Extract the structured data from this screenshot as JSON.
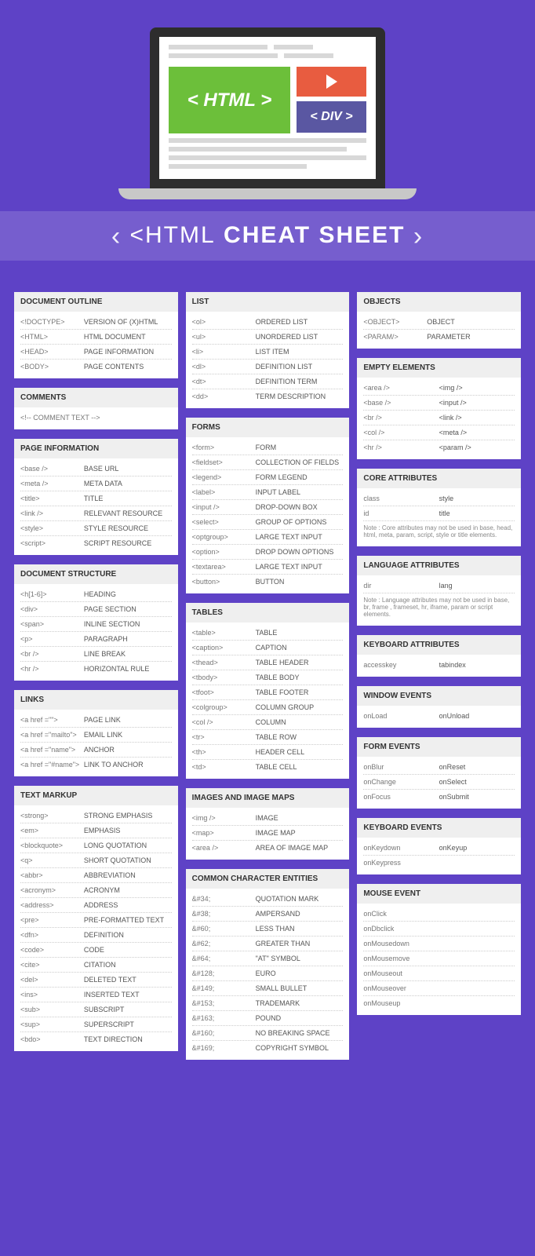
{
  "hero": {
    "htmlLabel": "< HTML >",
    "divLabel": "< DIV >"
  },
  "title": {
    "prefix": "<HTML",
    "bold": "CHEAT SHEET",
    "suffix": ">"
  },
  "col1": [
    {
      "title": "DOCUMENT OUTLINE",
      "rows": [
        [
          "<!DOCTYPE>",
          "VERSION OF (X)HTML"
        ],
        [
          "<HTML>",
          "HTML DOCUMENT"
        ],
        [
          "<HEAD>",
          "PAGE INFORMATION"
        ],
        [
          "<BODY>",
          "PAGE CONTENTS"
        ]
      ]
    },
    {
      "title": "COMMENTS",
      "rows": [
        [
          "<!-- COMMENT TEXT -->",
          ""
        ]
      ],
      "single": true
    },
    {
      "title": "PAGE INFORMATION",
      "rows": [
        [
          "<base />",
          "BASE URL"
        ],
        [
          "<meta />",
          "META DATA"
        ],
        [
          "<title>",
          "TITLE"
        ],
        [
          "<link />",
          "RELEVANT RESOURCE"
        ],
        [
          "<style>",
          "STYLE RESOURCE"
        ],
        [
          "<script>",
          "SCRIPT RESOURCE"
        ]
      ]
    },
    {
      "title": "DOCUMENT STRUCTURE",
      "rows": [
        [
          "<h[1-6]>",
          "HEADING"
        ],
        [
          "<div>",
          "PAGE SECTION"
        ],
        [
          "<span>",
          "INLINE SECTION"
        ],
        [
          "<p>",
          "PARAGRAPH"
        ],
        [
          "<br />",
          "LINE BREAK"
        ],
        [
          "<hr />",
          "HORIZONTAL RULE"
        ]
      ]
    },
    {
      "title": "LINKS",
      "rows": [
        [
          "<a href =\"\">",
          "PAGE LINK"
        ],
        [
          "<a href =\"mailto\">",
          "EMAIL LINK"
        ],
        [
          "<a href =\"name\">",
          "ANCHOR"
        ],
        [
          "<a href =\"#name\">",
          "LINK TO ANCHOR"
        ]
      ]
    },
    {
      "title": "TEXT MARKUP",
      "rows": [
        [
          "<strong>",
          "STRONG EMPHASIS"
        ],
        [
          "<em>",
          "EMPHASIS"
        ],
        [
          "<blockquote>",
          "LONG QUOTATION"
        ],
        [
          "<q>",
          "SHORT QUOTATION"
        ],
        [
          "<abbr>",
          "ABBREVIATION"
        ],
        [
          "<acronym>",
          "ACRONYM"
        ],
        [
          "<address>",
          "ADDRESS"
        ],
        [
          "<pre>",
          "PRE-FORMATTED TEXT"
        ],
        [
          "<dfn>",
          "DEFINITION"
        ],
        [
          "<code>",
          "CODE"
        ],
        [
          "<cite>",
          "CITATION"
        ],
        [
          "<del>",
          "DELETED TEXT"
        ],
        [
          "<ins>",
          "INSERTED TEXT"
        ],
        [
          "<sub>",
          "SUBSCRIPT"
        ],
        [
          "<sup>",
          "SUPERSCRIPT"
        ],
        [
          "<bdo>",
          "TEXT DIRECTION"
        ]
      ]
    }
  ],
  "col2": [
    {
      "title": "LIST",
      "rows": [
        [
          "<ol>",
          "ORDERED LIST"
        ],
        [
          "<ul>",
          "UNORDERED LIST"
        ],
        [
          "<li>",
          "LIST ITEM"
        ],
        [
          "<dl>",
          "DEFINITION LIST"
        ],
        [
          "<dt>",
          "DEFINITION TERM"
        ],
        [
          "<dd>",
          "TERM DESCRIPTION"
        ]
      ]
    },
    {
      "title": "FORMS",
      "rows": [
        [
          "<form>",
          "FORM"
        ],
        [
          "<fieldset>",
          "COLLECTION OF FIELDS"
        ],
        [
          "<legend>",
          "FORM LEGEND"
        ],
        [
          "<label>",
          "INPUT LABEL"
        ],
        [
          "<input />",
          "DROP-DOWN BOX"
        ],
        [
          "<select>",
          "GROUP OF OPTIONS"
        ],
        [
          "<optgroup>",
          "LARGE TEXT INPUT"
        ],
        [
          "<option>",
          "DROP DOWN OPTIONS"
        ],
        [
          "<textarea>",
          "LARGE TEXT INPUT"
        ],
        [
          "<button>",
          "BUTTON"
        ]
      ]
    },
    {
      "title": "TABLES",
      "rows": [
        [
          "<table>",
          "TABLE"
        ],
        [
          "<caption>",
          "CAPTION"
        ],
        [
          "<thead>",
          "TABLE HEADER"
        ],
        [
          "<tbody>",
          "TABLE BODY"
        ],
        [
          "<tfoot>",
          "TABLE FOOTER"
        ],
        [
          "<colgroup>",
          "COLUMN GROUP"
        ],
        [
          "<col />",
          "COLUMN"
        ],
        [
          "<tr>",
          "TABLE ROW"
        ],
        [
          "<th>",
          "HEADER CELL"
        ],
        [
          "<td>",
          "TABLE CELL"
        ]
      ]
    },
    {
      "title": "IMAGES AND IMAGE MAPS",
      "rows": [
        [
          "<img />",
          "IMAGE"
        ],
        [
          "<map>",
          "IMAGE MAP"
        ],
        [
          "<area />",
          "AREA OF IMAGE MAP"
        ]
      ]
    },
    {
      "title": "COMMON CHARACTER ENTITIES",
      "rows": [
        [
          "&#34;",
          "QUOTATION MARK"
        ],
        [
          "&#38;",
          "AMPERSAND"
        ],
        [
          "&#60;",
          "LESS THAN"
        ],
        [
          "&#62;",
          "GREATER THAN"
        ],
        [
          "&#64;",
          "\"AT\" SYMBOL"
        ],
        [
          "&#128;",
          "EURO"
        ],
        [
          "&#149;",
          "SMALL BULLET"
        ],
        [
          "&#153;",
          "TRADEMARK"
        ],
        [
          "&#163;",
          "POUND"
        ],
        [
          "&#160;",
          "NO BREAKING SPACE"
        ],
        [
          "&#169;",
          "COPYRIGHT SYMBOL"
        ]
      ]
    }
  ],
  "col3": [
    {
      "title": "OBJECTS",
      "rows": [
        [
          "<OBJECT>",
          "OBJECT"
        ],
        [
          "<PARAM/>",
          "PARAMETER"
        ]
      ]
    },
    {
      "title": "EMPTY ELEMENTS",
      "pair": true,
      "rows": [
        [
          "<area />",
          "<img />"
        ],
        [
          "<base />",
          "<input />"
        ],
        [
          "<br />",
          "<link />"
        ],
        [
          "<col />",
          "<meta />"
        ],
        [
          "<hr />",
          "<param />"
        ]
      ]
    },
    {
      "title": "CORE ATTRIBUTES",
      "pair": true,
      "rows": [
        [
          "class",
          "style"
        ],
        [
          "id",
          "title"
        ]
      ],
      "note": "Note : Core attributes may not be used in base, head, html, meta, param, script, style or title elements."
    },
    {
      "title": "LANGUAGE ATTRIBUTES",
      "pair": true,
      "rows": [
        [
          "dir",
          "lang"
        ]
      ],
      "note": "Note : Language attributes may not be used in base, br, frame , frameset, hr, iframe, param or script elements."
    },
    {
      "title": "KEYBOARD ATTRIBUTES",
      "pair": true,
      "rows": [
        [
          "accesskey",
          "tabindex"
        ]
      ]
    },
    {
      "title": "WINDOW EVENTS",
      "pair": true,
      "rows": [
        [
          "onLoad",
          "onUnload"
        ]
      ]
    },
    {
      "title": "FORM EVENTS",
      "pair": true,
      "rows": [
        [
          "onBlur",
          "onReset"
        ],
        [
          "onChange",
          "onSelect"
        ],
        [
          "onFocus",
          "onSubmit"
        ]
      ]
    },
    {
      "title": "KEYBOARD EVENTS",
      "pair": true,
      "rows": [
        [
          "onKeydown",
          "onKeyup"
        ],
        [
          "onKeypress",
          ""
        ]
      ]
    },
    {
      "title": "MOUSE EVENT",
      "rows": [
        [
          "onClick",
          ""
        ],
        [
          "onDbclick",
          ""
        ],
        [
          "onMousedown",
          ""
        ],
        [
          "onMousemove",
          ""
        ],
        [
          "onMouseout",
          ""
        ],
        [
          "onMouseover",
          ""
        ],
        [
          "onMouseup",
          ""
        ]
      ],
      "single": true
    }
  ]
}
